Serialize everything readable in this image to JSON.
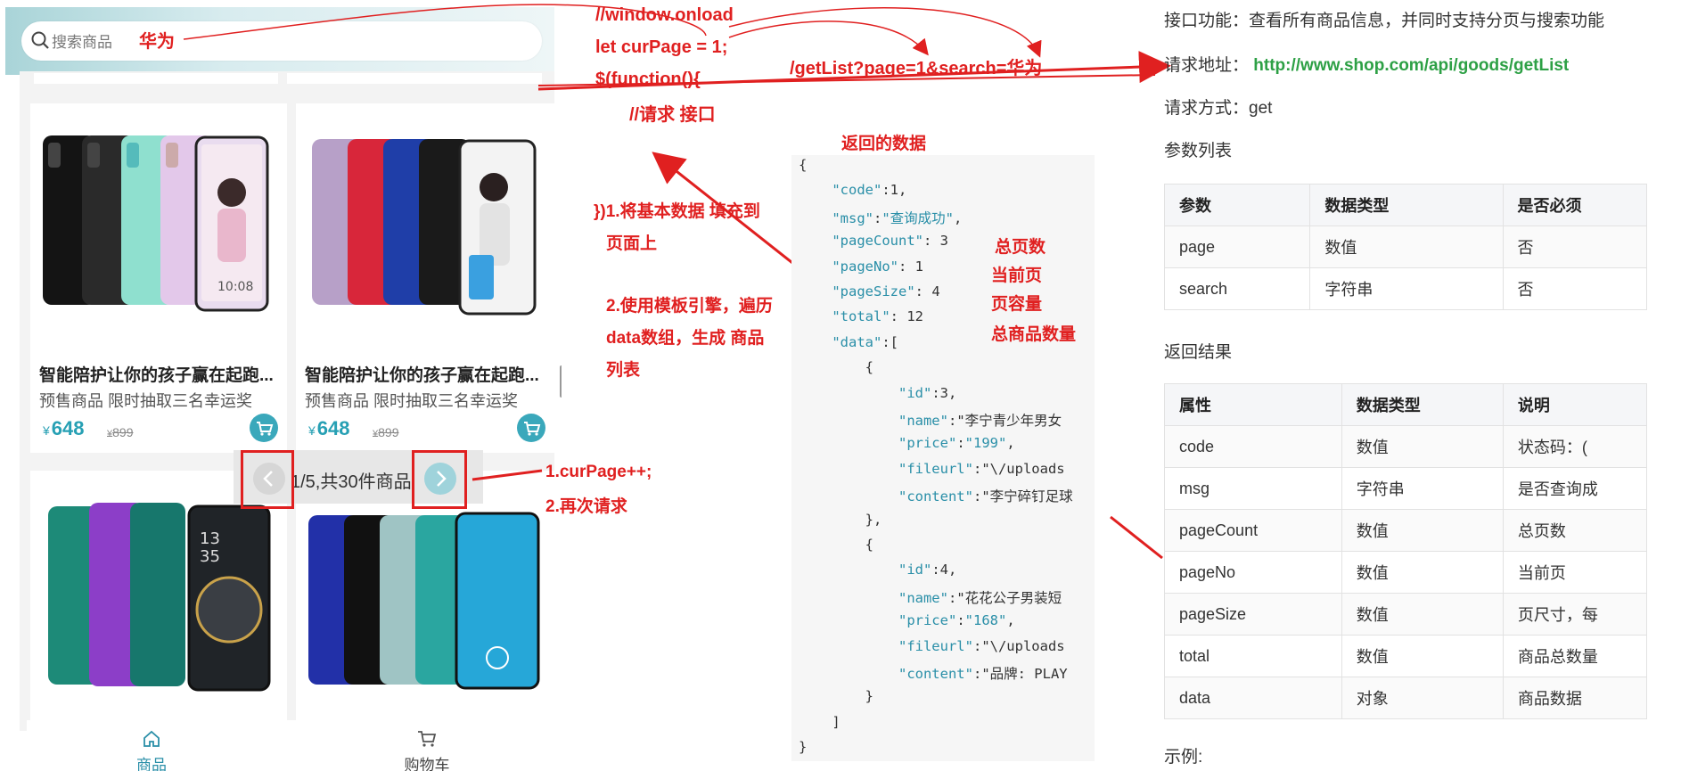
{
  "phone": {
    "search_placeholder": "搜索商品",
    "search_typed": "华为",
    "products": [
      {
        "title": "智能陪护让你的孩子赢在起跑...",
        "subtitle": "预售商品 限时抽取三名幸运奖",
        "price": "648",
        "old_price": "899"
      },
      {
        "title": "智能陪护让你的孩子赢在起跑...",
        "subtitle": "预售商品 限时抽取三名幸运奖",
        "price": "648",
        "old_price": "899"
      }
    ],
    "currency": "¥",
    "pager_text": "1/5,共30件商品",
    "tabs": [
      {
        "label": "商品",
        "icon": "home-icon",
        "active": true
      },
      {
        "label": "购物车",
        "icon": "cart-icon",
        "active": false
      }
    ],
    "accent_color": "#3aa8bb"
  },
  "annotations": {
    "code_lines": [
      "//window.onload",
      "let curPage  =  1;",
      "$(function(){",
      "//请求 接口"
    ],
    "request_url": "/getList?page=1&search=华为",
    "returned_data_label": "返回的数据",
    "step1": "})1.将基本数据 填充到",
    "step1b": "页面上",
    "step2a": "2.使用模板引擎，遍历",
    "step2b": "data数组，生成 商品",
    "step2c": "列表",
    "pager_note1": "1.curPage++;",
    "pager_note2": "2.再次请求",
    "field_notes": [
      "总页数",
      "当前页",
      "页容量",
      "总商品数量"
    ],
    "annotation_color": "#e02020"
  },
  "json_sample": {
    "lines": [
      "{",
      "    \"code\":1,",
      "    \"msg\":\"查询成功\",",
      "    \"pageCount\": 3",
      "    \"pageNo\": 1",
      "    \"pageSize\": 4",
      "    \"total\": 12",
      "    \"data\":[",
      "        {",
      "            \"id\":3,",
      "            \"name\":\"李宁青少年男女",
      "            \"price\":\"199\",",
      "            \"fileurl\":\"\\/uploads",
      "            \"content\":\"李宁碎钉足球",
      "        },",
      "        {",
      "            \"id\":4,",
      "            \"name\":\"花花公子男装短",
      "            \"price\":\"168\",",
      "            \"fileurl\":\"\\/uploads",
      "            \"content\":\"品牌: PLAY",
      "        }",
      "    ]",
      "}"
    ]
  },
  "api_doc": {
    "function_line": "接口功能：查看所有商品信息，并同时支持分页与搜索功能",
    "url_label": "请求地址：",
    "url": "http://www.shop.com/api/goods/getList",
    "method_line": "请求方式：get",
    "params_title": "参数列表",
    "params_headers": [
      "参数",
      "数据类型",
      "是否必须"
    ],
    "params_rows": [
      [
        "page",
        "数值",
        "否"
      ],
      [
        "search",
        "字符串",
        "否"
      ]
    ],
    "result_title": "返回结果",
    "result_headers": [
      "属性",
      "数据类型",
      "说明"
    ],
    "result_rows": [
      [
        "code",
        "数值",
        "状态码：("
      ],
      [
        "msg",
        "字符串",
        "是否查询成"
      ],
      [
        "pageCount",
        "数值",
        "总页数"
      ],
      [
        "pageNo",
        "数值",
        "当前页"
      ],
      [
        "pageSize",
        "数值",
        "页尺寸，每"
      ],
      [
        "total",
        "数值",
        "商品总数量"
      ],
      [
        "data",
        "对象",
        "商品数据"
      ]
    ],
    "example_label": "示例:"
  }
}
